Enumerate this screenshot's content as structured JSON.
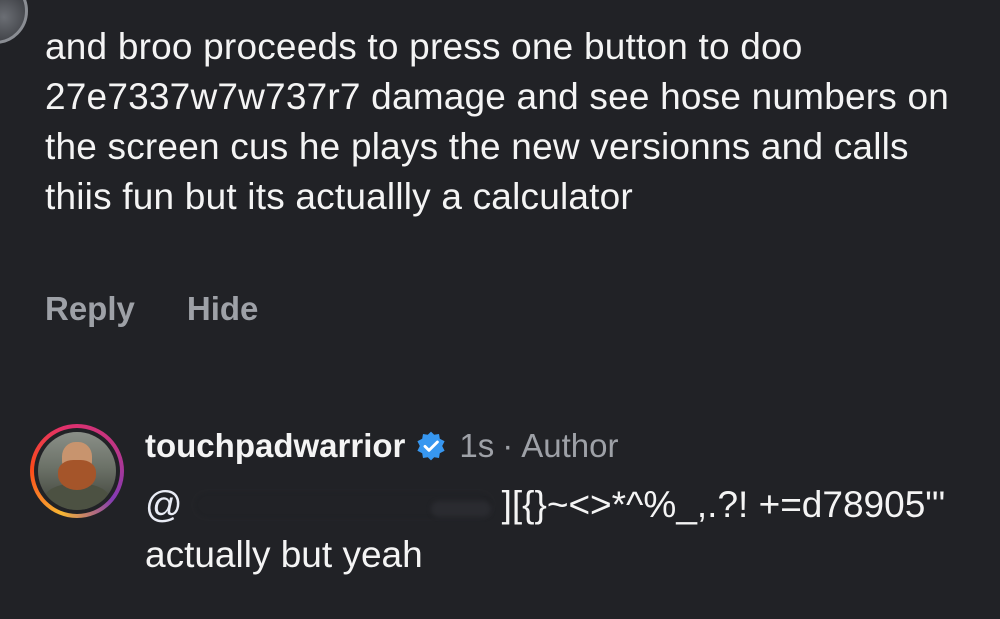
{
  "comment": {
    "text": "and broo proceeds to press one button to doo 27e7337w7w737r7 damage and see hose numbers on the screen cus he plays the new versionns and calls thiis fun but its actuallly a calculator",
    "actions": {
      "reply_label": "Reply",
      "hide_label": "Hide"
    }
  },
  "reply": {
    "username": "touchpadwarrior",
    "verified": true,
    "time": "1s",
    "separator": "·",
    "role": "Author",
    "mention_prefix": "@",
    "text_after_redaction": "][{}~<>*^%_,.?! +=d78905\"' actually but yeah"
  },
  "colors": {
    "background": "#212226",
    "text": "#f4f4f4",
    "muted": "#9ea1a7",
    "verified_badge": "#3797f0"
  },
  "icons": {
    "verified": "verified-badge-icon"
  }
}
